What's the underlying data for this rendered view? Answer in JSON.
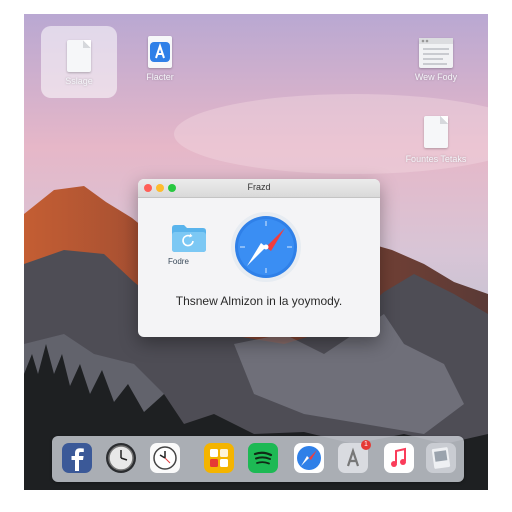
{
  "desktop": {
    "icons": [
      {
        "label": "Sslage",
        "icon": "document-icon"
      },
      {
        "label": "Flacter",
        "icon": "app-store-file-icon"
      },
      {
        "label": "Wew Fody",
        "icon": "text-document-icon"
      },
      {
        "label": "Fountes Tetaks",
        "icon": "document-icon"
      }
    ]
  },
  "window": {
    "title": "Frazd",
    "folder_label": "Fodre",
    "message": "Thsnew Almizon in la yoymody."
  },
  "dock": {
    "apps": [
      "Facebook",
      "Clock",
      "Clock",
      "Folders",
      "Spotify",
      "Safari",
      "App Store",
      "Music",
      "Preview"
    ],
    "badge": "1"
  },
  "colors": {
    "accent": "#2f80e8",
    "spotify": "#1db954",
    "facebook": "#3b5998",
    "close": "#ff5f57",
    "minimize": "#febc2e",
    "zoom": "#28c840"
  }
}
